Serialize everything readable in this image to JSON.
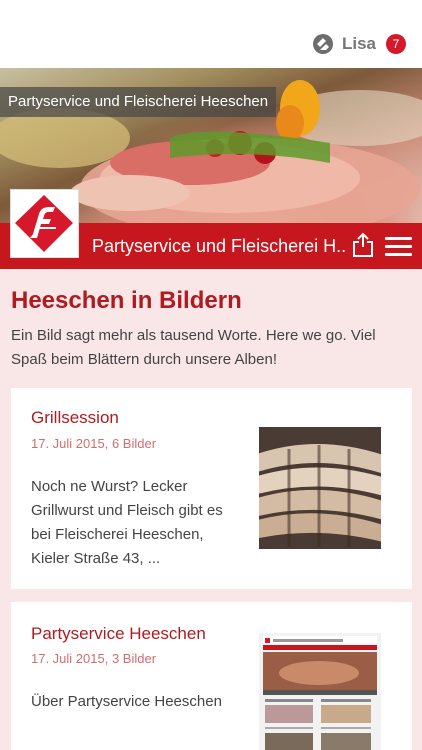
{
  "topbar": {
    "user_name": "Lisa",
    "notification_count": "7",
    "app_icon": "app-logo-icon"
  },
  "hero": {
    "caption": "Partyservice und Fleischerei Heeschen"
  },
  "brand": {
    "title": "Partyservice und Fleischerei H...",
    "accent_color": "#c6161e",
    "share_icon": "share-icon",
    "menu_icon": "hamburger-menu-icon"
  },
  "main": {
    "title": "Heeschen in Bildern",
    "intro": "Ein Bild sagt mehr als tausend Worte. Here we go. Viel Spaß beim Blättern durch unsere Alben!"
  },
  "albums": [
    {
      "title": "Grillsession",
      "meta": "17. Juli 2015, 6 Bilder",
      "text": "Noch ne Wurst? Lecker Grillwurst und Fleisch gibt es bei Fleischerei Heeschen, Kieler Straße 43, ..."
    },
    {
      "title": "Partyservice Heeschen",
      "meta": "17. Juli 2015, 3 Bilder",
      "text": "Über Partyservice Heeschen"
    }
  ]
}
